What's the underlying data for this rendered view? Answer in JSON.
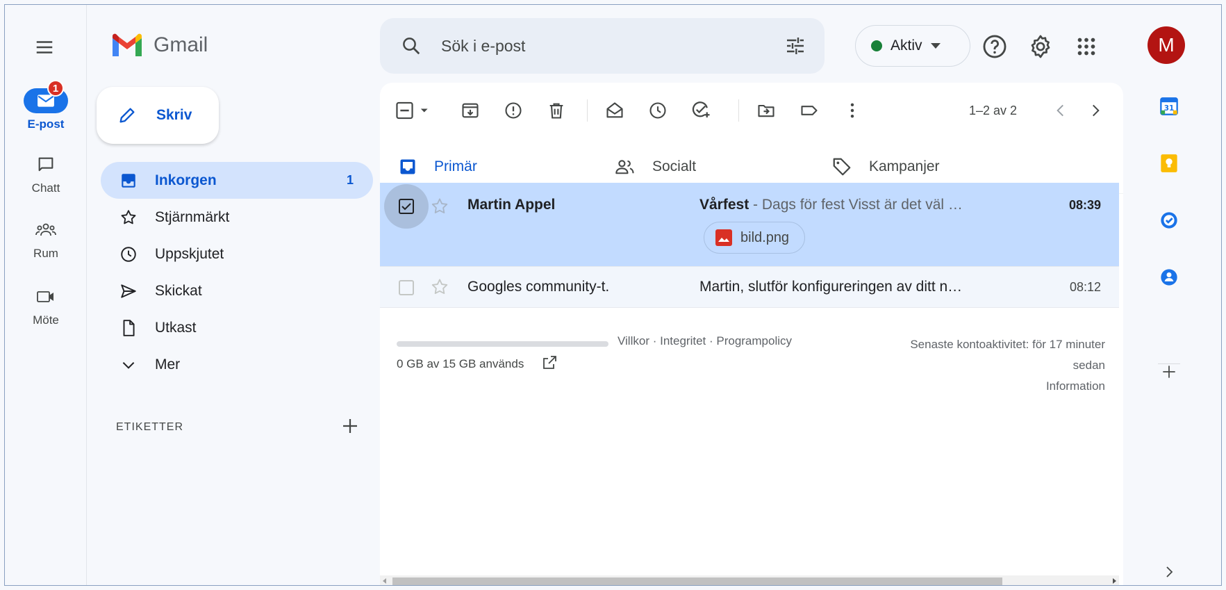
{
  "rail": {
    "items": [
      {
        "label": "E-post",
        "badge": "1"
      },
      {
        "label": "Chatt"
      },
      {
        "label": "Rum"
      },
      {
        "label": "Möte"
      }
    ]
  },
  "brand": {
    "name": "Gmail"
  },
  "compose": {
    "label": "Skriv"
  },
  "nav": {
    "items": [
      {
        "label": "Inkorgen",
        "count": "1",
        "icon": "inbox-icon"
      },
      {
        "label": "Stjärnmärkt",
        "icon": "star-icon"
      },
      {
        "label": "Uppskjutet",
        "icon": "clock-icon"
      },
      {
        "label": "Skickat",
        "icon": "send-icon"
      },
      {
        "label": "Utkast",
        "icon": "draft-icon"
      },
      {
        "label": "Mer",
        "icon": "chevron-down-icon"
      }
    ]
  },
  "labels": {
    "heading": "ETIKETTER"
  },
  "search": {
    "placeholder": "Sök i e-post"
  },
  "status": {
    "label": "Aktiv",
    "color": "#188038"
  },
  "account": {
    "initial": "M",
    "color": "#b31412"
  },
  "toolbar": {
    "pager": "1–2 av 2"
  },
  "tabs": [
    {
      "label": "Primär"
    },
    {
      "label": "Socialt"
    },
    {
      "label": "Kampanjer"
    }
  ],
  "emails": [
    {
      "sender": "Martin Appel",
      "subject": "Vårfest",
      "snippet": " - Dags för fest Visst är det väl …",
      "time": "08:39",
      "attachment": "bild.png",
      "selected": true
    },
    {
      "sender": "Googles community-t.",
      "subject": "",
      "snippet": "Martin, slutför konfigureringen av ditt n…",
      "time": "08:12",
      "selected": false
    }
  ],
  "footer": {
    "storage": "0 GB av 15 GB används",
    "links": [
      "Villkor",
      "Integritet",
      "Programpolicy"
    ],
    "separator": " · ",
    "activity": "Senaste kontoaktivitet: för 17 minuter sedan",
    "info": "Information"
  },
  "colors": {
    "accent": "#0b57d0",
    "selected_row": "#c2dbff",
    "active_nav": "#d3e3fd"
  }
}
